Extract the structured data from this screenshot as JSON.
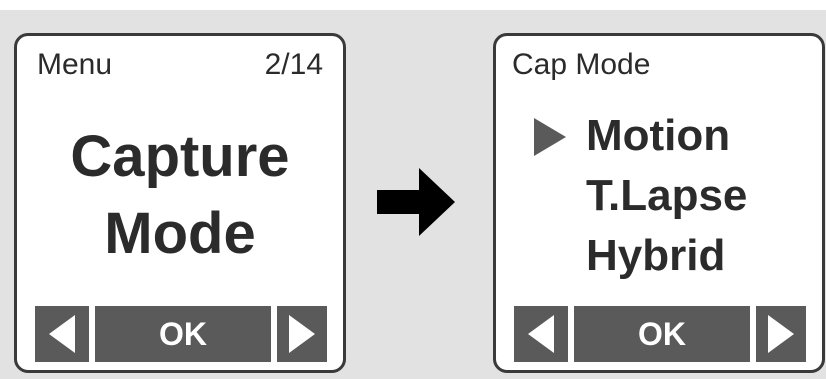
{
  "colors": {
    "background": "#e2e2e2",
    "screen": "#ffffff",
    "border": "#3a3a3a",
    "text": "#2b2b2b",
    "button": "#5a5a5a",
    "button_text": "#ffffff"
  },
  "left_screen": {
    "header_label": "Menu",
    "page_counter": "2/14",
    "title_line1": "Capture",
    "title_line2": "Mode",
    "buttons": {
      "left_icon": "left-triangle-icon",
      "ok_label": "OK",
      "right_icon": "right-triangle-icon"
    }
  },
  "transition_icon": "right-arrow-icon",
  "right_screen": {
    "header_label": "Cap Mode",
    "selection_icon": "selection-pointer-icon",
    "options": [
      "Motion",
      "T.Lapse",
      "Hybrid"
    ],
    "selected_option": "Motion",
    "buttons": {
      "left_icon": "left-triangle-icon",
      "ok_label": "OK",
      "right_icon": "right-triangle-icon"
    }
  }
}
